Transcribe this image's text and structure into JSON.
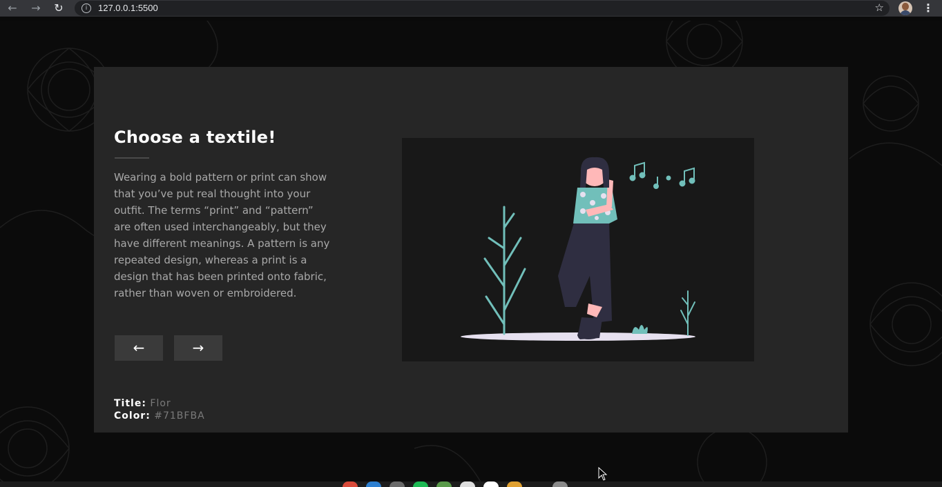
{
  "browser": {
    "url": "127.0.0.1:5500",
    "back_icon": "arrow-back-icon",
    "forward_icon": "arrow-forward-icon",
    "reload_icon": "reload-icon",
    "info_icon": "info-icon",
    "star_icon": "star-icon",
    "menu_icon": "kebab-menu-icon"
  },
  "card": {
    "title": "Choose a textile!",
    "description": "Wearing a bold pattern or print can show that you’ve put real thought into your outfit. The terms “print” and “pattern” are often used interchangeably, but they have different meanings. A pattern is any repeated design, whereas a print is a design that has been printed onto fabric, rather than woven or embroidered.",
    "prev_label": "←",
    "next_label": "→",
    "meta": {
      "title_key": "Title:",
      "title_value": "Flor",
      "color_key": "Color:",
      "color_value": "#71BFBA"
    }
  },
  "colors": {
    "accent": "#71BFBA",
    "card_bg": "#262626",
    "page_bg": "#0b0b0b"
  }
}
